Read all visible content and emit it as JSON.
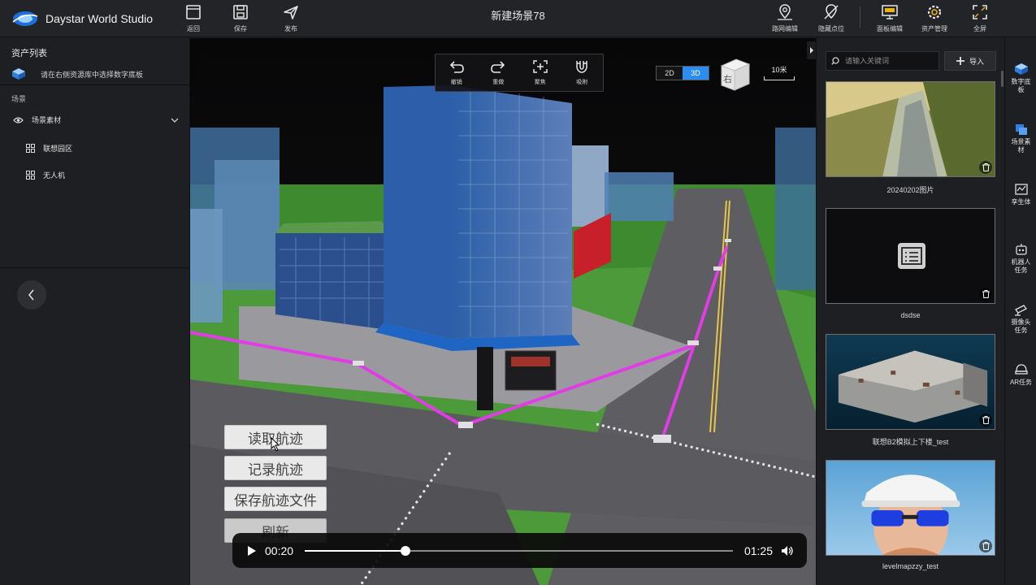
{
  "app": {
    "title": "Daystar World Studio",
    "scene_title": "新建场景78"
  },
  "toolbar": {
    "left": [
      {
        "label": "返回",
        "icon": "exit-icon"
      },
      {
        "label": "保存",
        "icon": "save-icon"
      },
      {
        "label": "发布",
        "icon": "publish-icon"
      }
    ],
    "right": [
      {
        "label": "路网编辑",
        "icon": "road-network-icon"
      },
      {
        "label": "隐藏点位",
        "icon": "hide-point-icon"
      },
      {
        "label": "面板编辑",
        "icon": "panel-edit-icon"
      },
      {
        "label": "资产管理",
        "icon": "asset-manage-icon"
      },
      {
        "label": "全屏",
        "icon": "fullscreen-icon"
      }
    ]
  },
  "left_panel": {
    "asset_list_title": "资产列表",
    "hint": "请在右侧资源库中选择数字底板",
    "scene_section": "场景",
    "scene_material": "场景素材",
    "items": [
      "联想园区",
      "无人机"
    ]
  },
  "viewport": {
    "tools": [
      {
        "label": "撤销",
        "icon": "undo-icon"
      },
      {
        "label": "重做",
        "icon": "redo-icon"
      },
      {
        "label": "聚焦",
        "icon": "focus-icon"
      },
      {
        "label": "吸附",
        "icon": "magnet-icon"
      }
    ],
    "modes": [
      "2D",
      "3D"
    ],
    "active_mode": "3D",
    "nav_cube_face": "右",
    "scale_label": "10米",
    "track_buttons": [
      "读取航迹",
      "记录航迹",
      "保存航迹文件",
      "刷新"
    ]
  },
  "player": {
    "current_time": "00:20",
    "total_time": "01:25",
    "progress_percent": 23.5
  },
  "assets": {
    "search_placeholder": "请输入关键词",
    "import_label": "导入",
    "cards": [
      {
        "name": "20240202图片",
        "thumb": "river-photo"
      },
      {
        "name": "dsdse",
        "thumb": "document-icon"
      },
      {
        "name": "联想B2模拟上下楼_test",
        "thumb": "point-cloud"
      },
      {
        "name": "levelmapzzy_test",
        "thumb": "avatar-helmet"
      }
    ]
  },
  "right_nav": [
    {
      "label": "数字底板",
      "icon": "digital-base-icon"
    },
    {
      "label": "场景素材",
      "icon": "scene-material-icon"
    },
    {
      "label": "孪生体",
      "icon": "twin-icon"
    },
    {
      "label": "机器人任务",
      "icon": "robot-icon"
    },
    {
      "label": "摄像头任务",
      "icon": "camera-icon"
    },
    {
      "label": "AR任务",
      "icon": "ar-helmet-icon"
    }
  ],
  "colors": {
    "accent": "#2d8cf0",
    "flight_path": "#e23ce6",
    "background": "#1e1f22"
  }
}
